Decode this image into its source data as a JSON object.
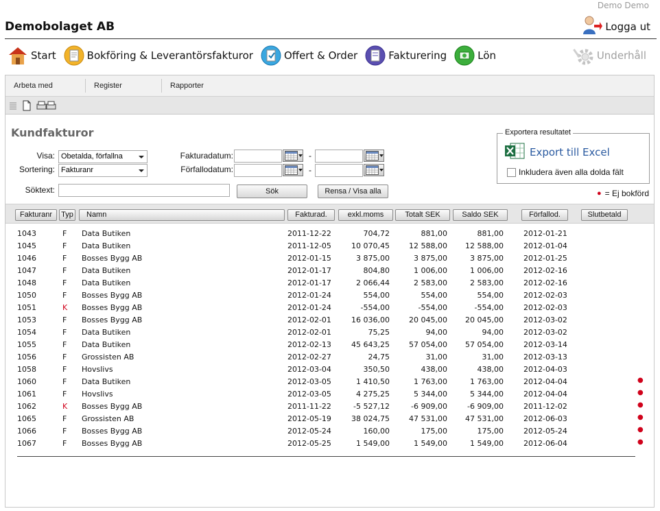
{
  "header": {
    "user": "Demo Demo",
    "company": "Demobolaget AB",
    "logout_label": "Logga ut"
  },
  "mainnav": {
    "items": [
      {
        "label": "Start",
        "icon": "house-icon"
      },
      {
        "label": "Bokföring & Leverantörsfakturor",
        "icon": "bookkeeping-icon"
      },
      {
        "label": "Offert & Order",
        "icon": "offer-order-icon"
      },
      {
        "label": "Fakturering",
        "icon": "invoicing-icon"
      },
      {
        "label": "Lön",
        "icon": "salary-icon"
      }
    ],
    "maintenance_label": "Underhåll"
  },
  "subnav": {
    "tabs": [
      "Arbeta med",
      "Register",
      "Rapporter"
    ]
  },
  "page": {
    "title": "Kundfakturor"
  },
  "filters": {
    "visa_label": "Visa:",
    "visa_value": "Obetalda, förfallna",
    "sortering_label": "Sortering:",
    "sortering_value": "Fakturanr",
    "fakturadatum_label": "Fakturadatum:",
    "forfallodatum_label": "Förfallodatum:",
    "range_sep": "-",
    "soktext_label": "Söktext:",
    "search_button": "Sök",
    "clear_button": "Rensa / Visa alla"
  },
  "export": {
    "legend": "Exportera resultatet",
    "excel_label": "Export till Excel",
    "include_hidden_label": "Inkludera även alla dolda fält"
  },
  "legend_note": "= Ej bokförd",
  "colors": {
    "red_dot": "#d0021b",
    "link_blue": "#2a5aa0"
  },
  "table": {
    "headers": [
      "Fakturanr",
      "Typ",
      "Namn",
      "Fakturad.",
      "exkl.moms",
      "Totalt SEK",
      "Saldo SEK",
      "Förfallod.",
      "Slutbetald"
    ],
    "rows": [
      {
        "nr": "1043",
        "typ": "F",
        "namn": "Data Butiken",
        "fdat": "2011-12-22",
        "excl": "704,72",
        "tot": "881,00",
        "saldo": "881,00",
        "forf": "2012-01-21",
        "ej_bokford": false
      },
      {
        "nr": "1045",
        "typ": "F",
        "namn": "Data Butiken",
        "fdat": "2011-12-05",
        "excl": "10 070,45",
        "tot": "12 588,00",
        "saldo": "12 588,00",
        "forf": "2012-01-04",
        "ej_bokford": false
      },
      {
        "nr": "1046",
        "typ": "F",
        "namn": "Bosses Bygg AB",
        "fdat": "2012-01-15",
        "excl": "3 875,00",
        "tot": "3 875,00",
        "saldo": "3 875,00",
        "forf": "2012-01-25",
        "ej_bokford": false
      },
      {
        "nr": "1047",
        "typ": "F",
        "namn": "Data Butiken",
        "fdat": "2012-01-17",
        "excl": "804,80",
        "tot": "1 006,00",
        "saldo": "1 006,00",
        "forf": "2012-02-16",
        "ej_bokford": false
      },
      {
        "nr": "1048",
        "typ": "F",
        "namn": "Data Butiken",
        "fdat": "2012-01-17",
        "excl": "2 066,44",
        "tot": "2 583,00",
        "saldo": "2 583,00",
        "forf": "2012-02-16",
        "ej_bokford": false
      },
      {
        "nr": "1050",
        "typ": "F",
        "namn": "Bosses Bygg AB",
        "fdat": "2012-01-24",
        "excl": "554,00",
        "tot": "554,00",
        "saldo": "554,00",
        "forf": "2012-02-03",
        "ej_bokford": false
      },
      {
        "nr": "1051",
        "typ": "K",
        "namn": "Bosses Bygg AB",
        "fdat": "2012-01-24",
        "excl": "-554,00",
        "tot": "-554,00",
        "saldo": "-554,00",
        "forf": "2012-02-03",
        "ej_bokford": false
      },
      {
        "nr": "1053",
        "typ": "F",
        "namn": "Bosses Bygg AB",
        "fdat": "2012-02-01",
        "excl": "16 036,00",
        "tot": "20 045,00",
        "saldo": "20 045,00",
        "forf": "2012-03-02",
        "ej_bokford": false
      },
      {
        "nr": "1054",
        "typ": "F",
        "namn": "Data Butiken",
        "fdat": "2012-02-01",
        "excl": "75,25",
        "tot": "94,00",
        "saldo": "94,00",
        "forf": "2012-03-02",
        "ej_bokford": false
      },
      {
        "nr": "1055",
        "typ": "F",
        "namn": "Data Butiken",
        "fdat": "2012-02-13",
        "excl": "45 643,25",
        "tot": "57 054,00",
        "saldo": "57 054,00",
        "forf": "2012-03-14",
        "ej_bokford": false
      },
      {
        "nr": "1056",
        "typ": "F",
        "namn": "Grossisten AB",
        "fdat": "2012-02-27",
        "excl": "24,75",
        "tot": "31,00",
        "saldo": "31,00",
        "forf": "2012-03-13",
        "ej_bokford": false
      },
      {
        "nr": "1058",
        "typ": "F",
        "namn": "Hovslivs",
        "fdat": "2012-03-04",
        "excl": "350,50",
        "tot": "438,00",
        "saldo": "438,00",
        "forf": "2012-04-03",
        "ej_bokford": false
      },
      {
        "nr": "1060",
        "typ": "F",
        "namn": "Data Butiken",
        "fdat": "2012-03-05",
        "excl": "1 410,50",
        "tot": "1 763,00",
        "saldo": "1 763,00",
        "forf": "2012-04-04",
        "ej_bokford": true
      },
      {
        "nr": "1061",
        "typ": "F",
        "namn": "Hovslivs",
        "fdat": "2012-03-05",
        "excl": "4 275,25",
        "tot": "5 344,00",
        "saldo": "5 344,00",
        "forf": "2012-04-04",
        "ej_bokford": true
      },
      {
        "nr": "1062",
        "typ": "K",
        "namn": "Bosses Bygg AB",
        "fdat": "2011-11-22",
        "excl": "-5 527,12",
        "tot": "-6 909,00",
        "saldo": "-6 909,00",
        "forf": "2011-12-02",
        "ej_bokford": true
      },
      {
        "nr": "1065",
        "typ": "F",
        "namn": "Grossisten AB",
        "fdat": "2012-05-19",
        "excl": "38 024,75",
        "tot": "47 531,00",
        "saldo": "47 531,00",
        "forf": "2012-06-03",
        "ej_bokford": true
      },
      {
        "nr": "1066",
        "typ": "F",
        "namn": "Bosses Bygg AB",
        "fdat": "2012-05-24",
        "excl": "160,00",
        "tot": "175,00",
        "saldo": "175,00",
        "forf": "2012-05-24",
        "ej_bokford": true
      },
      {
        "nr": "1067",
        "typ": "F",
        "namn": "Bosses Bygg AB",
        "fdat": "2012-05-25",
        "excl": "1 549,00",
        "tot": "1 549,00",
        "saldo": "1 549,00",
        "forf": "2012-06-04",
        "ej_bokford": true
      }
    ]
  }
}
